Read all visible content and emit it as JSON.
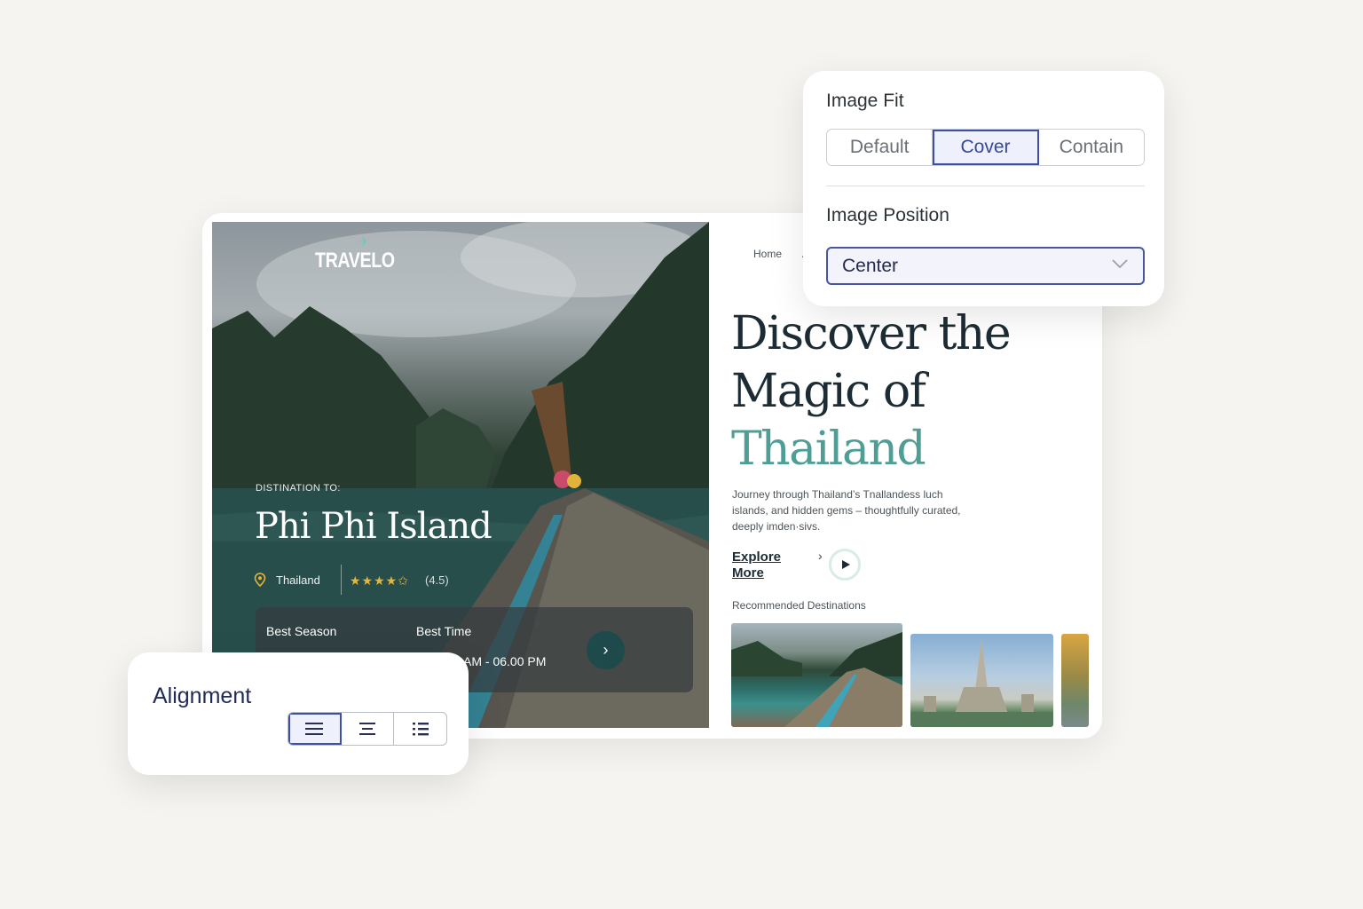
{
  "brand": {
    "logo_text": "TRAVELO"
  },
  "hero": {
    "kicker": "DISTINATION TO:",
    "title": "Phi Phi Island",
    "country": "Thailand",
    "stars": "★★★★✩",
    "rating_text": "(4.5)",
    "rating_value": 4.5,
    "season_label": "Best Season",
    "time_label": "Best Time",
    "time_value": "AM - 06.00 PM"
  },
  "nav": {
    "home": "Home",
    "second": "A"
  },
  "headline": {
    "line1": "Discover the",
    "line2": "Magic of",
    "line3": "Thailand"
  },
  "body_text": "Journey through Thailand’s Tnallandess luch islands, and hidden gems – thoughtfully curated, deeply imden·sivs.",
  "explore": {
    "label": "Explore More"
  },
  "recommended": {
    "label": "Recommended Destinations"
  },
  "image_fit": {
    "title": "Image Fit",
    "options": [
      "Default",
      "Cover",
      "Contain"
    ],
    "selected": "Cover"
  },
  "image_position": {
    "title": "Image Position",
    "value": "Center"
  },
  "alignment": {
    "title": "Alignment",
    "options": [
      "align-left-icon",
      "align-center-icon",
      "list-icon"
    ],
    "selected": "align-left-icon"
  },
  "colors": {
    "accent_teal": "#4e9e96",
    "active_blue": "#3e4fa6",
    "star_gold": "#e9b43a",
    "dark_text": "#1d2c34"
  }
}
